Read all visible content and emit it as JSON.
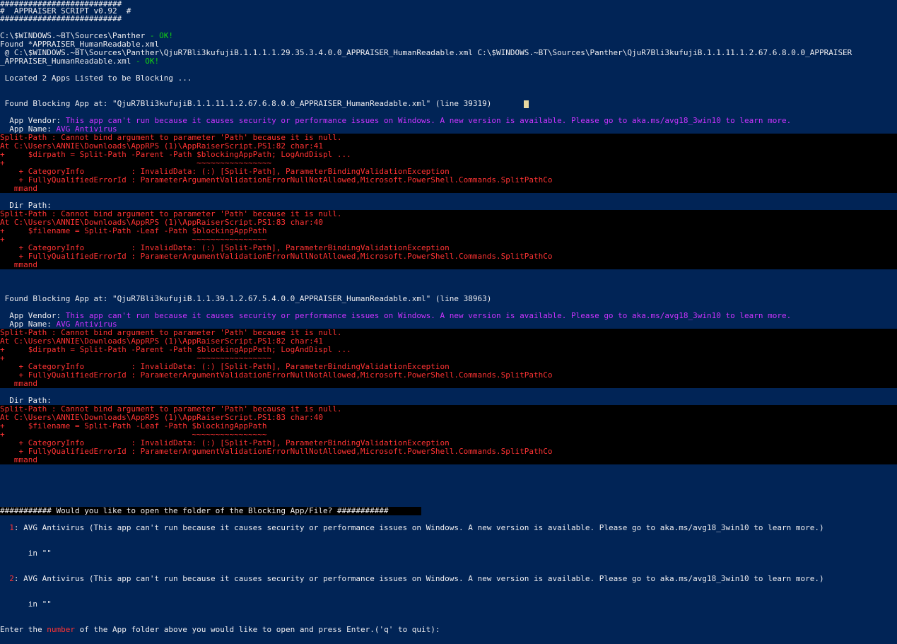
{
  "colors": {
    "background": "#012456",
    "text": "#eeedf0",
    "error_text": "#ff3333",
    "error_background": "#000000",
    "ok": "#13d313",
    "vendor_message": "#cc33ff",
    "cursor": "#e8d8a0"
  },
  "banner": {
    "border": "##########################",
    "title": "#  APPRAISER SCRIPT v0.92  #"
  },
  "paths": {
    "panther_path": "C:\\$WINDOWS.~BT\\Sources\\Panther",
    "ok_label": " - OK!",
    "found_line": "Found *APPRAISER_HumanReadable.xml",
    "found_files_line": " @ C:\\$WINDOWS.~BT\\Sources\\Panther\\QjuR7Bli3kufujiB.1.1.1.1.29.35.3.4.0.0_APPRAISER_HumanReadable.xml C:\\$WINDOWS.~BT\\Sources\\Panther\\QjuR7Bli3kufujiB.1.1.11.1.2.67.6.8.0.0_APPRAISER",
    "found_files_cont": "_APPRAISER_HumanReadable.xml"
  },
  "located_line": " Located 2 Apps Listed to be Blocking ...",
  "blocking_apps": [
    {
      "found_line": " Found Blocking App at: \"QjuR7Bli3kufujiB.1.1.11.1.2.67.6.8.0.0_APPRAISER_HumanReadable.xml\" (line 39319)",
      "vendor_label": "  App Vendor: ",
      "vendor_value": "This app can't run because it causes security or performance issues on Windows. A new version is available. Please go to aka.ms/avg18_3win10 to learn more.",
      "name_label": "  App Name: ",
      "name_value": "AVG Antivirus",
      "dir_label": "  Dir Path:",
      "error1": [
        "Split-Path : Cannot bind argument to parameter 'Path' because it is null.",
        "At C:\\Users\\ANNIE\\Downloads\\AppRPS (1)\\AppRaiserScript.PS1:82 char:41",
        "+     $dirpath = Split-Path -Parent -Path $blockingAppPath; LogAndDispl ...",
        "+                                         ~~~~~~~~~~~~~~~~",
        "    + CategoryInfo          : InvalidData: (:) [Split-Path], ParameterBindingValidationException",
        "    + FullyQualifiedErrorId : ParameterArgumentValidationErrorNullNotAllowed,Microsoft.PowerShell.Commands.SplitPathCo",
        "   mmand"
      ],
      "error2": [
        "Split-Path : Cannot bind argument to parameter 'Path' because it is null.",
        "At C:\\Users\\ANNIE\\Downloads\\AppRPS (1)\\AppRaiserScript.PS1:83 char:40",
        "+     $filename = Split-Path -Leaf -Path $blockingAppPath",
        "+                                        ~~~~~~~~~~~~~~~~",
        "    + CategoryInfo          : InvalidData: (:) [Split-Path], ParameterBindingValidationException",
        "    + FullyQualifiedErrorId : ParameterArgumentValidationErrorNullNotAllowed,Microsoft.PowerShell.Commands.SplitPathCo",
        "   mmand"
      ]
    },
    {
      "found_line": " Found Blocking App at: \"QjuR7Bli3kufujiB.1.1.39.1.2.67.5.4.0.0_APPRAISER_HumanReadable.xml\" (line 38963)",
      "vendor_label": "  App Vendor: ",
      "vendor_value": "This app can't run because it causes security or performance issues on Windows. A new version is available. Please go to aka.ms/avg18_3win10 to learn more.",
      "name_label": "  App Name: ",
      "name_value": "AVG Antivirus",
      "dir_label": "  Dir Path:",
      "error1": [
        "Split-Path : Cannot bind argument to parameter 'Path' because it is null.",
        "At C:\\Users\\ANNIE\\Downloads\\AppRPS (1)\\AppRaiserScript.PS1:82 char:41",
        "+     $dirpath = Split-Path -Parent -Path $blockingAppPath; LogAndDispl ...",
        "+                                         ~~~~~~~~~~~~~~~~",
        "    + CategoryInfo          : InvalidData: (:) [Split-Path], ParameterBindingValidationException",
        "    + FullyQualifiedErrorId : ParameterArgumentValidationErrorNullNotAllowed,Microsoft.PowerShell.Commands.SplitPathCo",
        "   mmand"
      ],
      "error2": [
        "Split-Path : Cannot bind argument to parameter 'Path' because it is null.",
        "At C:\\Users\\ANNIE\\Downloads\\AppRPS (1)\\AppRaiserScript.PS1:83 char:40",
        "+     $filename = Split-Path -Leaf -Path $blockingAppPath",
        "+                                        ~~~~~~~~~~~~~~~~",
        "    + CategoryInfo          : InvalidData: (:) [Split-Path], ParameterBindingValidationException",
        "    + FullyQualifiedErrorId : ParameterArgumentValidationErrorNullNotAllowed,Microsoft.PowerShell.Commands.SplitPathCo",
        "   mmand"
      ]
    }
  ],
  "prompt": {
    "header": "########### Would you like to open the folder of the Blocking App/File? ###########",
    "options": [
      {
        "number": "1",
        "text": ": AVG Antivirus (This app can't run because it causes security or performance issues on Windows. A new version is available. Please go to aka.ms/avg18_3win10 to learn more.)",
        "location": "      in \"\""
      },
      {
        "number": "2",
        "text": ": AVG Antivirus (This app can't run because it causes security or performance issues on Windows. A new version is available. Please go to aka.ms/avg18_3win10 to learn more.)",
        "location": "      in \"\""
      }
    ],
    "input_prefix": "Enter the ",
    "input_highlight": "number",
    "input_suffix": " of the App folder above you would like to open and press Enter.('q' to quit):"
  }
}
